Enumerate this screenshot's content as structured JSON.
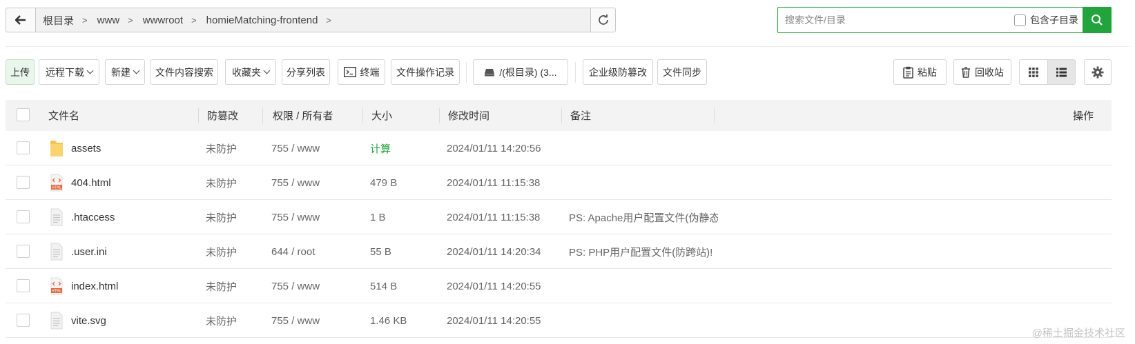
{
  "breadcrumb": {
    "items": [
      "根目录",
      "www",
      "wwwroot",
      "homieMatching-frontend"
    ]
  },
  "search": {
    "placeholder": "搜索文件/目录",
    "include_subdir_label": "包含子目录"
  },
  "toolbar": {
    "upload": "上传",
    "remote_download": "远程下载",
    "new": "新建",
    "content_search": "文件内容搜索",
    "favorites": "收藏夹",
    "share_list": "分享列表",
    "terminal": "终端",
    "operation_log": "文件操作记录",
    "disk": "/(根目录) (3...",
    "tamper_proof": "企业级防篡改",
    "file_sync": "文件同步",
    "paste": "粘贴",
    "recycle_bin": "回收站"
  },
  "table": {
    "headers": {
      "name": "文件名",
      "tamper": "防篡改",
      "permission": "权限 / 所有者",
      "size": "大小",
      "mtime": "修改时间",
      "note": "备注",
      "actions": "操作"
    },
    "rows": [
      {
        "name": "assets",
        "icon": "folder-icon",
        "tamper": "未防护",
        "permission": "755 / www",
        "size": "计算",
        "mtime": "2024/01/11 14:20:56",
        "note": ""
      },
      {
        "name": "404.html",
        "icon": "html-file-icon",
        "tamper": "未防护",
        "permission": "755 / www",
        "size": "479 B",
        "mtime": "2024/01/11 11:15:38",
        "note": ""
      },
      {
        "name": ".htaccess",
        "icon": "text-file-icon",
        "tamper": "未防护",
        "permission": "755 / www",
        "size": "1 B",
        "mtime": "2024/01/11 11:15:38",
        "note": "PS: Apache用户配置文件(伪静态"
      },
      {
        "name": ".user.ini",
        "icon": "text-file-icon",
        "tamper": "未防护",
        "permission": "644 / root",
        "size": "55 B",
        "mtime": "2024/01/11 14:20:34",
        "note": "PS: PHP用户配置文件(防跨站)!"
      },
      {
        "name": "index.html",
        "icon": "html-file-icon",
        "tamper": "未防护",
        "permission": "755 / www",
        "size": "514 B",
        "mtime": "2024/01/11 14:20:55",
        "note": ""
      },
      {
        "name": "vite.svg",
        "icon": "text-file-icon",
        "tamper": "未防护",
        "permission": "755 / www",
        "size": "1.46 KB",
        "mtime": "2024/01/11 14:20:55",
        "note": ""
      }
    ]
  },
  "watermark": "@稀土掘金技术社区",
  "colors": {
    "accent": "#20a53a",
    "header_bg": "#f3f3f3",
    "folder": "#f7c34c",
    "html_badge": "#e8693a"
  }
}
